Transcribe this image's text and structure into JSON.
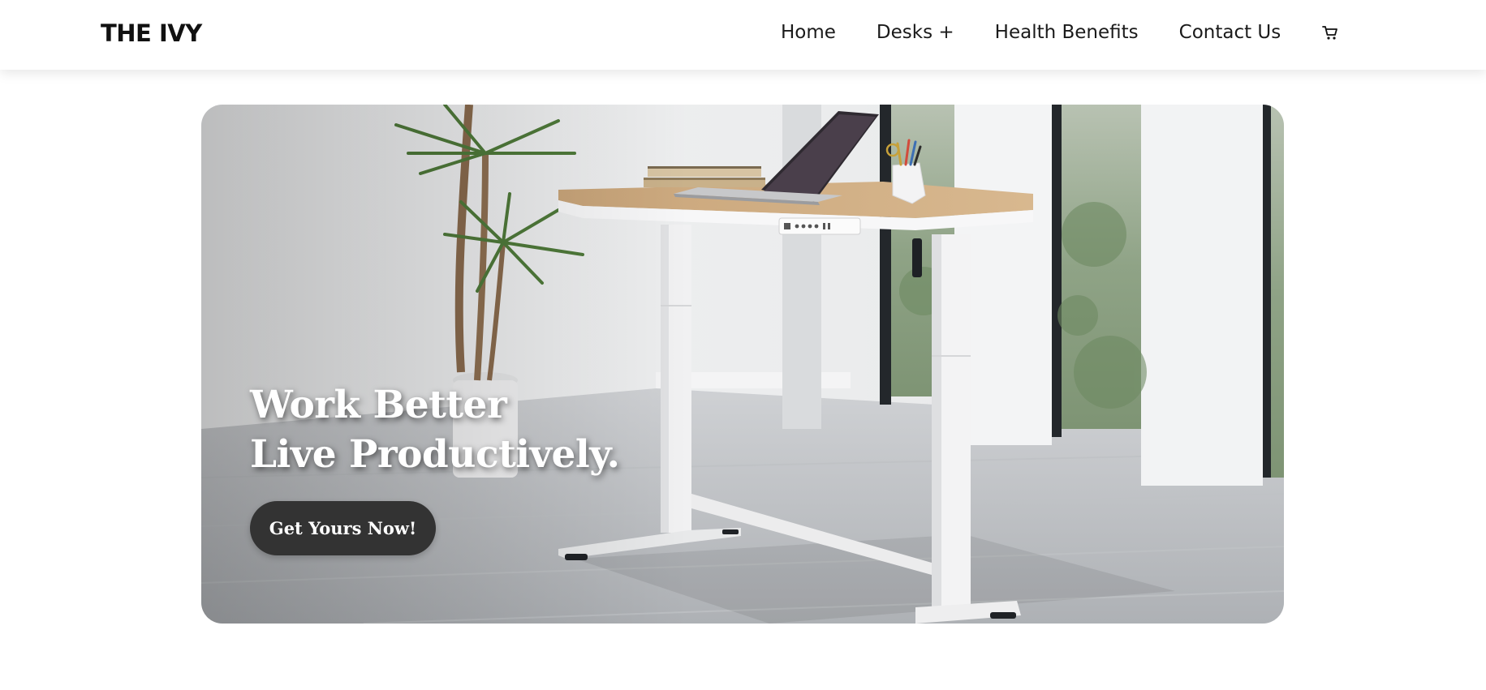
{
  "header": {
    "brand": "THE IVY",
    "nav": {
      "home": "Home",
      "desks": "Desks +",
      "health": "Health Benefits",
      "contact": "Contact Us"
    },
    "cart_icon": "cart-icon"
  },
  "hero": {
    "headline_line1": "Work Better",
    "headline_line2": "Live Productively.",
    "cta_label": "Get Yours Now!",
    "image_description_icon": "standing-desk-photo"
  },
  "colors": {
    "cta_bg": "#333333",
    "text_dark": "#1a1a1a",
    "hero_text": "#ffffff"
  }
}
